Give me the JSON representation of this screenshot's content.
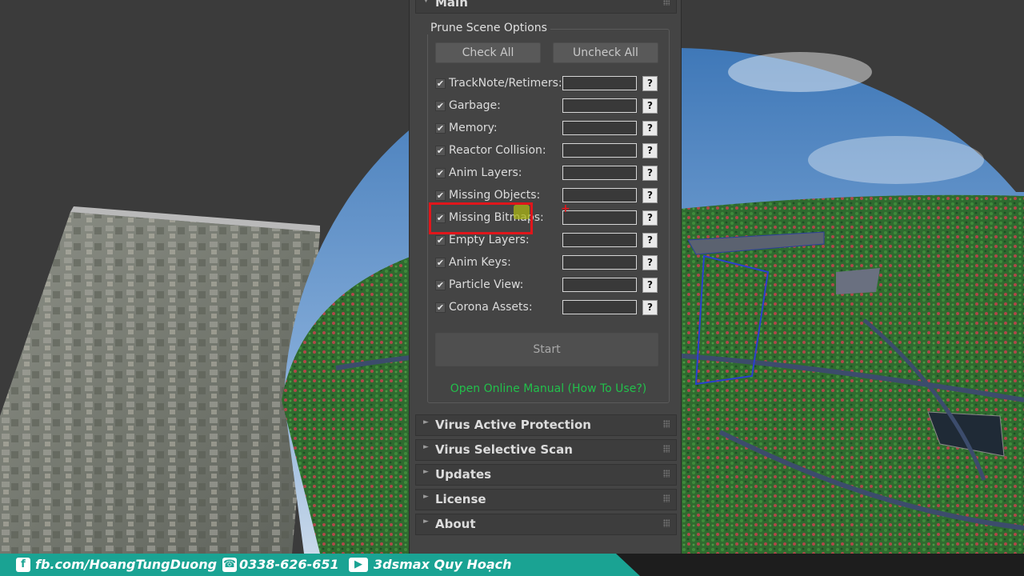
{
  "panel": {
    "main_rollout": "Main",
    "group_title": "Prune Scene Options",
    "check_all": "Check All",
    "uncheck_all": "Uncheck All",
    "options": [
      {
        "label": "TrackNote/Retimers:",
        "checked": true
      },
      {
        "label": "Garbage:",
        "checked": true
      },
      {
        "label": "Memory:",
        "checked": true
      },
      {
        "label": "Reactor Collision:",
        "checked": true
      },
      {
        "label": "Anim Layers:",
        "checked": true
      },
      {
        "label": "Missing Objects:",
        "checked": true
      },
      {
        "label": "Missing Bitmaps:",
        "checked": true
      },
      {
        "label": "Empty Layers:",
        "checked": true
      },
      {
        "label": "Anim Keys:",
        "checked": true
      },
      {
        "label": "Particle View:",
        "checked": true
      },
      {
        "label": "Corona Assets:",
        "checked": true
      }
    ],
    "help_label": "?",
    "start": "Start",
    "manual_link": "Open Online Manual (How To Use?)",
    "rollouts": [
      "Virus Active Protection",
      "Virus Selective Scan",
      "Updates",
      "License",
      "About"
    ]
  },
  "footer": {
    "facebook": "fb.com/HoangTungDuong",
    "phone": "0338-626-651",
    "youtube": "3dsmax Quy Hoạch"
  },
  "colors": {
    "highlight": "#e0161b",
    "link": "#22c04b",
    "footer_accent": "#1aa393"
  }
}
